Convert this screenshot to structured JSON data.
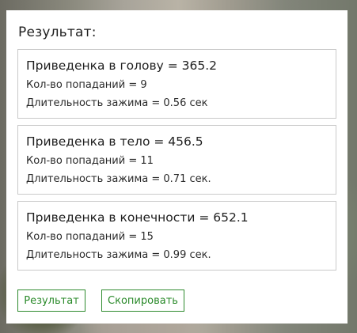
{
  "title": "Результат:",
  "results": [
    {
      "heading": "Приведенка в голову = 365.2",
      "hits": "Кол-во попаданий = 9",
      "hold": "Длительность зажима = 0.56 сек"
    },
    {
      "heading": "Приведенка в тело = 456.5",
      "hits": "Кол-во попаданий = 11",
      "hold": "Длительность зажима = 0.71 сек."
    },
    {
      "heading": "Приведенка в конечности = 652.1",
      "hits": "Кол-во попаданий = 15",
      "hold": "Длительность зажима = 0.99 сек."
    }
  ],
  "buttons": {
    "result_label": "Результат",
    "copy_label": "Скопировать"
  },
  "colors": {
    "button_accent": "#2e8b2e"
  }
}
